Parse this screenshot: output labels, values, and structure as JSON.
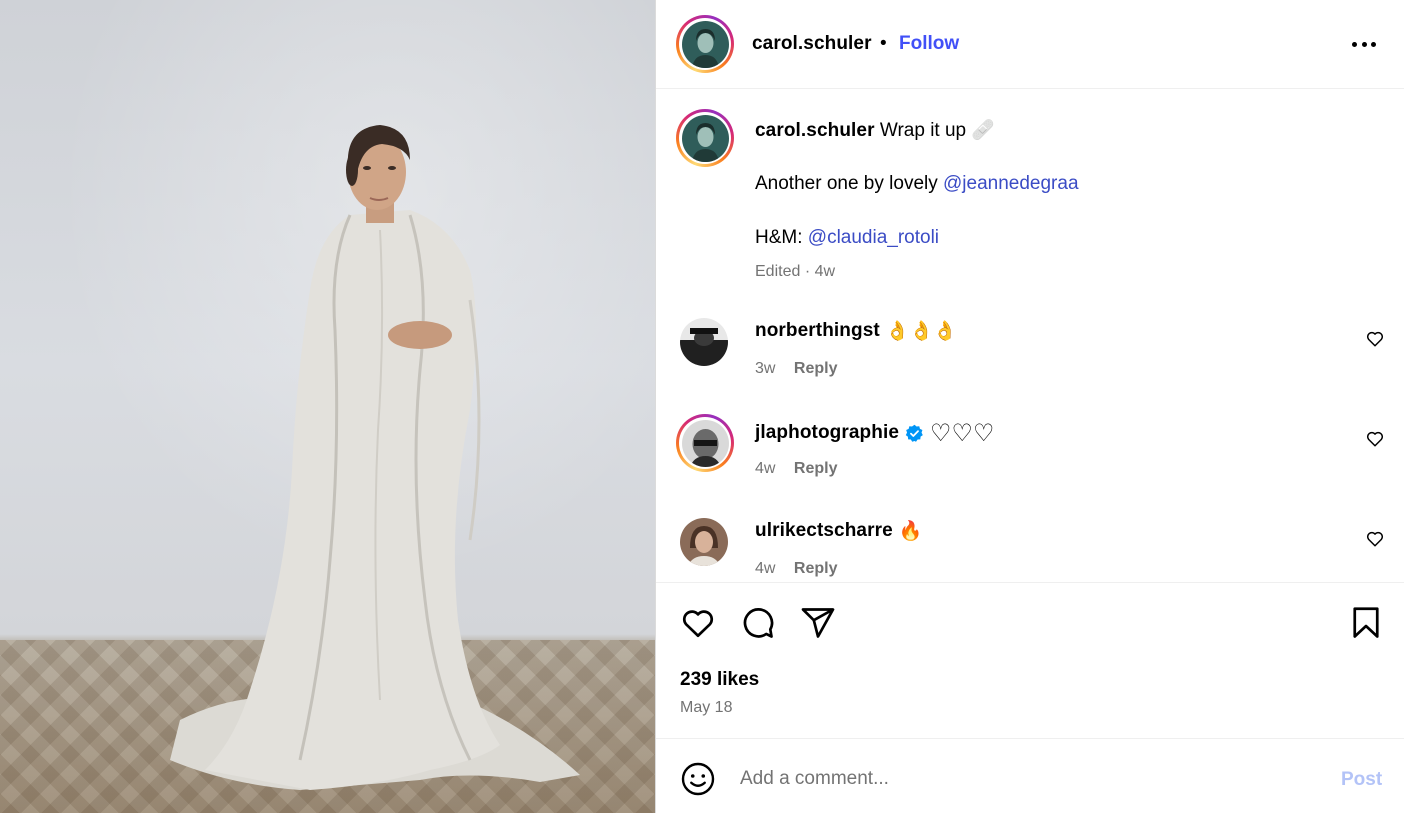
{
  "post": {
    "author": "carol.schuler",
    "separator": "•",
    "follow_label": "Follow",
    "more_icon": "more-horizontal-icon",
    "image_description_icon": "photo-icon"
  },
  "caption": {
    "username": "carol.schuler",
    "line1_text": "Wrap it up",
    "line1_emoji": "🩹",
    "line2_prefix": "Another one by lovely",
    "line2_mention": "@jeannedegraa",
    "line3_prefix": "H&M:",
    "line3_mention": "@claudia_rotoli",
    "meta": "Edited · 4w"
  },
  "comments": [
    {
      "username": "norberthingst",
      "text": "👌👌👌",
      "time": "3w",
      "reply_label": "Reply",
      "verified": false
    },
    {
      "username": "jlaphotographie",
      "text": "♡♡♡",
      "time": "4w",
      "reply_label": "Reply",
      "verified": true
    },
    {
      "username": "ulrikectscharre",
      "text": "🔥",
      "time": "4w",
      "reply_label": "Reply",
      "verified": false
    }
  ],
  "actions": {
    "like_icon": "heart-icon",
    "comment_icon": "comment-icon",
    "share_icon": "paper-plane-icon",
    "save_icon": "bookmark-icon",
    "likes": "239 likes",
    "date": "May 18"
  },
  "add_comment": {
    "emoji_icon": "smile-icon",
    "placeholder": "Add a comment...",
    "post_label": "Post"
  },
  "colors": {
    "follow": "#4150f7",
    "mention": "#3b4cc5",
    "meta": "#737373",
    "post_disabled": "#b3c3f7",
    "verified": "#0095f6"
  }
}
